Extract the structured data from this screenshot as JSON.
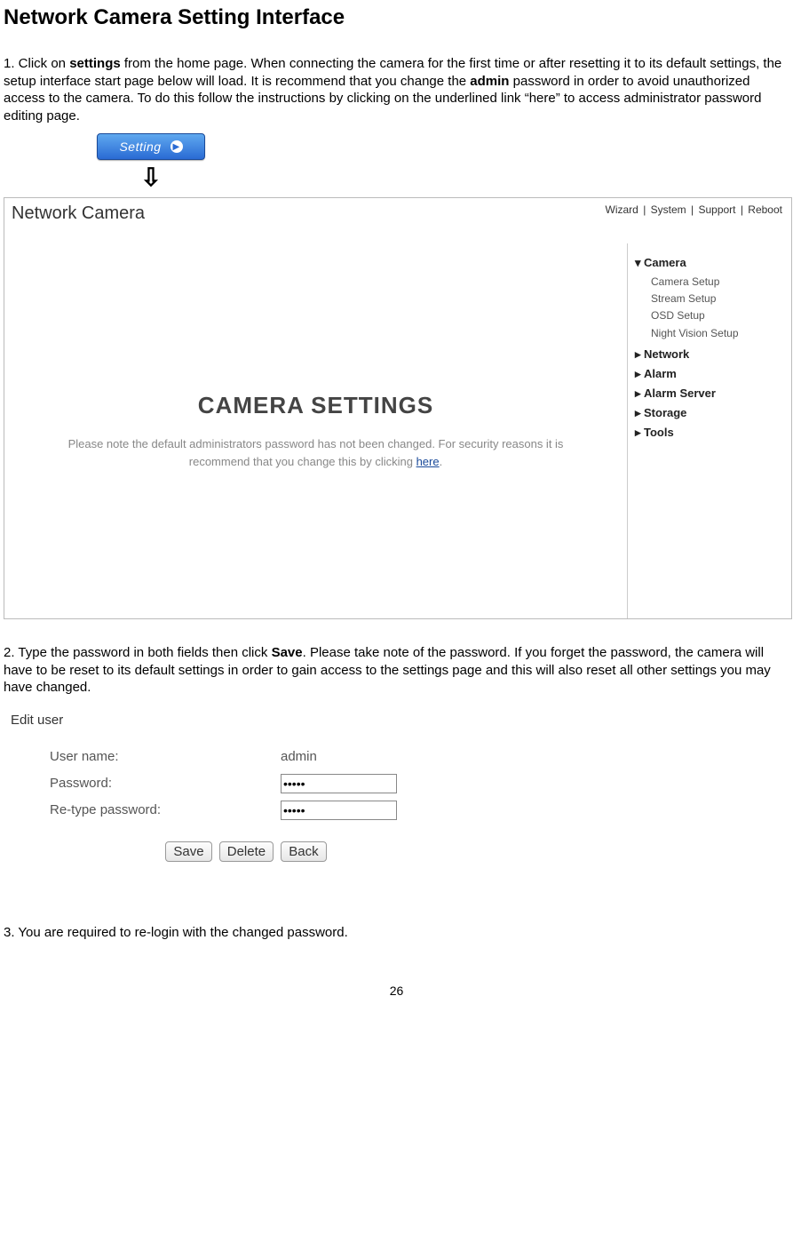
{
  "page": {
    "title": "Network Camera Setting Interface",
    "page_number": "26"
  },
  "steps": {
    "s1a": "1. Click on ",
    "s1_settings": "settings",
    "s1b": " from the home page. When connecting the camera for the first time or after resetting it to its default settings, the setup interface start page below will load. It is recommend that you change the ",
    "s1_admin": "admin",
    "s1c": " password in order to avoid unauthorized access to the camera. To do this follow the instructions by clicking on the underlined link “here” to access administrator password editing page.",
    "s2a": "2. Type the password in both fields then click ",
    "s2_save": "Save",
    "s2b": ". Please take note of the password. If you forget the password, the camera will have to be reset to its default settings in order to gain access to the settings page and this will also reset all other settings you may have changed.",
    "s3": "3. You are required to re-login with the changed password."
  },
  "setting_button": {
    "label": "Setting",
    "arrow_icon": "➜"
  },
  "panel": {
    "title": "Network Camera",
    "top_links": [
      "Wizard",
      "System",
      "Support",
      "Reboot"
    ],
    "main_heading": "CAMERA SETTINGS",
    "note_a": "Please note the default administrators password has not been changed. For security reasons it is recommend that you change this by clicking ",
    "note_link": "here",
    "note_b": ".",
    "side": {
      "camera": {
        "label": "Camera",
        "items": [
          "Camera Setup",
          "Stream Setup",
          "OSD Setup",
          "Night Vision Setup"
        ]
      },
      "groups": [
        "Network",
        "Alarm",
        "Alarm Server",
        "Storage",
        "Tools"
      ]
    }
  },
  "edit_user": {
    "title": "Edit user",
    "username_label": "User name:",
    "username_value": "admin",
    "password_label": "Password:",
    "retype_label": "Re-type password:",
    "password_value": "•••••",
    "buttons": {
      "save": "Save",
      "delete": "Delete",
      "back": "Back"
    }
  }
}
